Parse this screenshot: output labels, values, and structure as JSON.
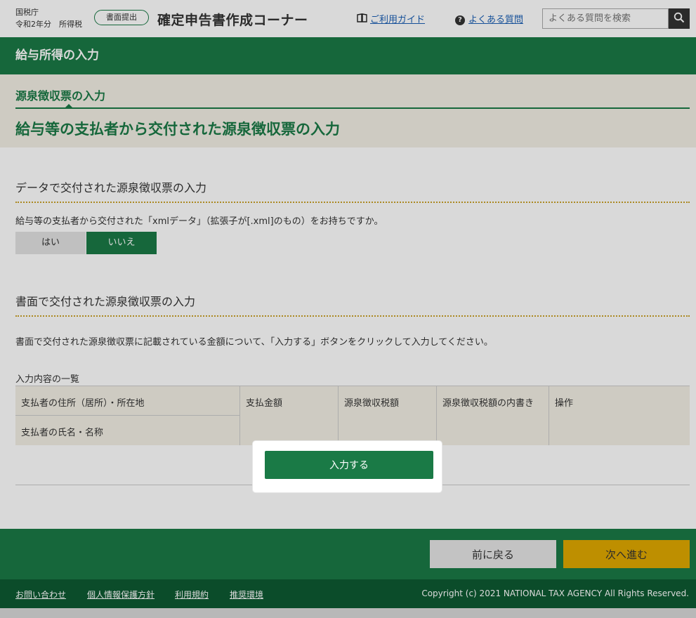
{
  "header": {
    "agency": "国税庁",
    "year_tax": "令和2年分　所得税",
    "mode_pill": "書面提出",
    "title": "確定申告書作成コーナー",
    "guide_link": "ご利用ガイド",
    "faq_link": "よくある質問",
    "search_placeholder": "よくある質問を検索"
  },
  "section_bar": "給与所得の入力",
  "step": {
    "label": "源泉徴収票の入力",
    "title": "給与等の支払者から交付された源泉徴収票の入力"
  },
  "data_section": {
    "heading": "データで交付された源泉徴収票の入力",
    "question": "給与等の支払者から交付された「xmlデータ」（拡張子が[.xml]のもの）をお持ちですか。",
    "yes": "はい",
    "no": "いいえ"
  },
  "paper_section": {
    "heading": "書面で交付された源泉徴収票の入力",
    "instruction": "書面で交付された源泉徴収票に記載されている金額について、「入力する」ボタンをクリックして入力してください。",
    "list_label": "入力内容の一覧",
    "columns": {
      "address": "支払者の住所（居所）・所在地",
      "name": "支払者の氏名・名称",
      "amount": "支払金額",
      "tax": "源泉徴収税額",
      "breakdown": "源泉徴収税額の内書き",
      "operation": "操作"
    },
    "input_button": "入力する"
  },
  "nav": {
    "back": "前に戻る",
    "next": "次へ進む"
  },
  "footer": {
    "links": [
      "お問い合わせ",
      "個人情報保護方針",
      "利用規約",
      "推奨環境"
    ],
    "copyright": "Copyright (c) 2021 NATIONAL TAX AGENCY All Rights Reserved."
  },
  "colors": {
    "brand_green": "#1a7a46",
    "accent_yellow": "#e0a800"
  }
}
